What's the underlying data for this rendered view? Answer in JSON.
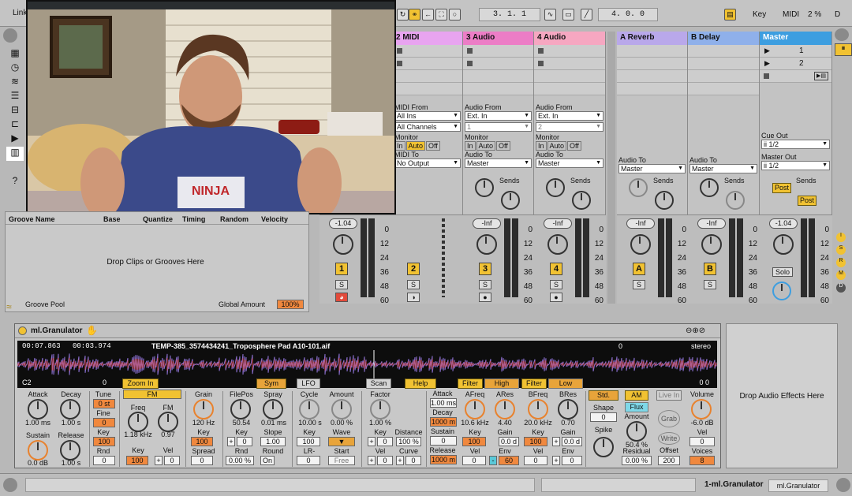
{
  "topbar": {
    "link_label": "Link",
    "position": "3.  1.  1",
    "loop_length": "4.  0.  0",
    "key_label": "Key",
    "midi_label": "MIDI",
    "cpu": "2 %",
    "d_label": "D"
  },
  "tracks": [
    {
      "name": "2 MIDI",
      "color": "#e8a4f0",
      "routing_from_label": "MIDI From",
      "from": "All Ins",
      "sub": "All Channels",
      "monitor_label": "Monitor",
      "monitor": [
        "In",
        "Auto",
        "Off"
      ],
      "to_label": "MIDI To",
      "to": "No Output",
      "vol": "",
      "num": "2"
    },
    {
      "name": "3 Audio",
      "color": "#ec7dc6",
      "routing_from_label": "Audio From",
      "from": "Ext. In",
      "sub": "1",
      "monitor_label": "Monitor",
      "monitor": [
        "In",
        "Auto",
        "Off"
      ],
      "to_label": "Audio To",
      "to": "Master",
      "vol": "-Inf",
      "num": "3",
      "sends_label": "Sends"
    },
    {
      "name": "4 Audio",
      "color": "#f6a7c1",
      "routing_from_label": "Audio From",
      "from": "Ext. In",
      "sub": "2",
      "monitor_label": "Monitor",
      "monitor": [
        "In",
        "Auto",
        "Off"
      ],
      "to_label": "Audio To",
      "to": "Master",
      "vol": "-Inf",
      "num": "4",
      "sends_label": "Sends"
    },
    {
      "name": "A Reverb",
      "color": "#b9a8ea",
      "to_label": "Audio To",
      "to": "Master",
      "vol": "-Inf",
      "num": "A",
      "sends_label": "Sends"
    },
    {
      "name": "B Delay",
      "color": "#8fb0ea",
      "to_label": "Audio To",
      "to": "Master",
      "vol": "-Inf",
      "num": "B",
      "sends_label": "Sends"
    },
    {
      "name": "Master",
      "color": "#3d9ee0",
      "scenes": [
        "1",
        "2"
      ],
      "cue_label": "Cue Out",
      "cue": "ii 1/2",
      "master_label": "Master Out",
      "master": "ii 1/2",
      "vol": "-1.04",
      "solo": "Solo",
      "post": "Post",
      "sends_label": "Sends"
    }
  ],
  "track1_vol": "-1.04",
  "track1_num": "1",
  "scale": [
    "0",
    "12",
    "24",
    "36",
    "48",
    "60"
  ],
  "solo_s": "S",
  "groove": {
    "cols": [
      "Groove Name",
      "Base",
      "Quantize",
      "Timing",
      "Random",
      "Velocity"
    ],
    "drop": "Drop Clips or Grooves Here",
    "pool": "Groove Pool",
    "global_label": "Global Amount",
    "global": "100%"
  },
  "device": {
    "name": "ml.Granulator",
    "time1": "00:07.863",
    "time2": "00:03.974",
    "file": "TEMP-385_3574434241_Troposphere Pad A10-101.aif",
    "stereo": "stereo",
    "marker0": "0",
    "marker0b": "0",
    "marker00": "0  0",
    "note": "C2",
    "zoom": "Zoom In",
    "sym": "Sym",
    "lfo": "LFO",
    "scan": "Scan",
    "help": "Help",
    "filter1": "Filter",
    "high": "High",
    "filter2": "Filter",
    "low": "Low",
    "fm": "FM",
    "attack_l": "Attack",
    "attack_v": "1.00 ms",
    "decay_l": "Decay",
    "decay_v": "1.00 s",
    "sustain_l": "Sustain",
    "sustain_v": "0.0 dB",
    "release_l": "Release",
    "release_v": "1.00 s",
    "tune_l": "Tune",
    "tune_v": "0 st",
    "fine_l": "Fine",
    "fine_v": "0",
    "key_l": "Key",
    "key_v": "100",
    "rnd_l": "Rnd",
    "rnd_v": "0",
    "freq_l": "Freq",
    "freq_v": "1.18 kHz",
    "fm_l": "FM",
    "fm_v": "0.97",
    "fkey_l": "Key",
    "fkey_v": "100",
    "fvel_l": "Vel",
    "fvel_v": "0",
    "grain_l": "Grain",
    "grain_v": "120 Hz",
    "gkey_l": "Key",
    "gkey_v": "100",
    "spread_l": "Spread",
    "spread_v": "0",
    "filepos_l": "FilePos",
    "filepos_v": "50.54",
    "fpkey_l": "Key",
    "fpkey_v": "0",
    "fprnd_l": "Rnd",
    "fprnd_v": "0.00 %",
    "spray_l": "Spray",
    "spray_v": "0.01 ms",
    "slope_l": "Slope",
    "slope_v": "1.00",
    "round_l": "Round",
    "round_v": "On",
    "cycle_l": "Cycle",
    "cycle_v": "10.00 s",
    "ckey_l": "Key",
    "ckey_v": "100",
    "lr_l": "LR-Phase",
    "lr_v": "0",
    "amount_l": "Amount",
    "amount_v": "0.00 %",
    "wave_l": "Wave",
    "start_l": "Start",
    "start_v": "Free",
    "factor_l": "Factor",
    "factor_v": "1.00 %",
    "fckey_l": "Key",
    "fckey_v": "0",
    "dist_l": "Distance",
    "dist_v": "100 %",
    "fcvel_l": "Vel",
    "curve_l": "Curve",
    "fattack_l": "Attack",
    "fattack_v": "1.00 ms",
    "fdecay_l": "Decay",
    "fdecay_v": "1000 m",
    "fsus_l": "Sustain",
    "fsus_v": "0",
    "frel_l": "Release",
    "frel_v": "1000 m",
    "afreq_l": "AFreq",
    "afreq_v": "10.6 kHz",
    "ares_l": "ARes",
    "ares_v": "4.40",
    "akey_l": "Key",
    "akey_v": "100",
    "again_l": "Gain",
    "again_v": "0.0 d",
    "avel_l": "Vel",
    "aenv_l": "Env",
    "aenv_v": "60",
    "bfreq_l": "BFreq",
    "bfreq_v": "20.0 kHz",
    "bres_l": "BRes",
    "bres_v": "0.70",
    "bkey_l": "Key",
    "bkey_v": "100",
    "bgain_l": "Gain",
    "bgain_v": "0.0 d",
    "bvel_l": "Vel",
    "benv_l": "Env",
    "std": "Std.",
    "shape_l": "Shape",
    "shape_v": "0",
    "spike_l": "Spike",
    "am": "AM",
    "flux": "Flux",
    "am_amount_l": "Amount",
    "am_amount_v": "50.4 %",
    "residual_l": "Residual",
    "residual_v": "0.00 %",
    "livein": "Live In",
    "grab": "Grab",
    "write": "Write",
    "offset_l": "Offset",
    "offset_v": "200",
    "volume_l": "Volume",
    "volume_v": "-6.0 dB",
    "vvel_l": "Vel",
    "vvel_v": "0",
    "voices_l": "Voices",
    "voices_v": "8",
    "zero": "0",
    "plus": "+"
  },
  "dropfx": "Drop Audio Effects Here",
  "status": {
    "chain_label": "1-ml.Granulator",
    "chain_tab": "ml.Granulator"
  }
}
